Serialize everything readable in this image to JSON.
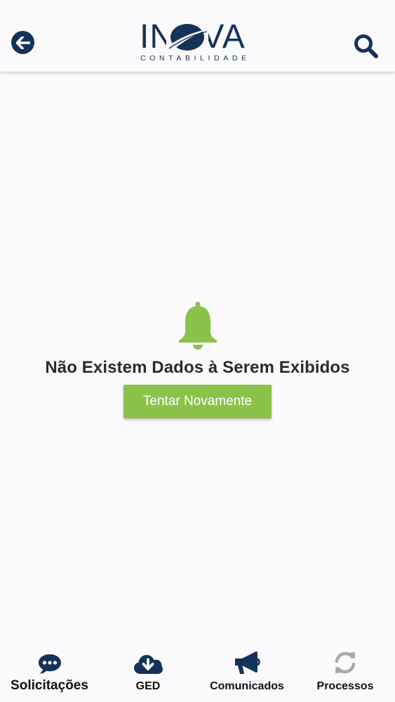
{
  "header": {
    "logo_main": "INOVA",
    "logo_sub": "CONTABILIDADE"
  },
  "empty_state": {
    "message": "Não Existem Dados à Serem Exibidos",
    "retry_label": "Tentar Novamente"
  },
  "bottom_nav": {
    "items": [
      {
        "label": "Solicitações",
        "icon": "chat-bubble-icon",
        "active": true
      },
      {
        "label": "GED",
        "icon": "cloud-download-icon",
        "active": false
      },
      {
        "label": "Comunicados",
        "icon": "megaphone-icon",
        "active": false
      },
      {
        "label": "Processos",
        "icon": "sync-icon",
        "active": false
      }
    ]
  },
  "colors": {
    "brand_navy": "#15335a",
    "accent_green": "#8bc34a",
    "inactive_gray": "#a9a9a9",
    "background": "#fbfbfd"
  }
}
